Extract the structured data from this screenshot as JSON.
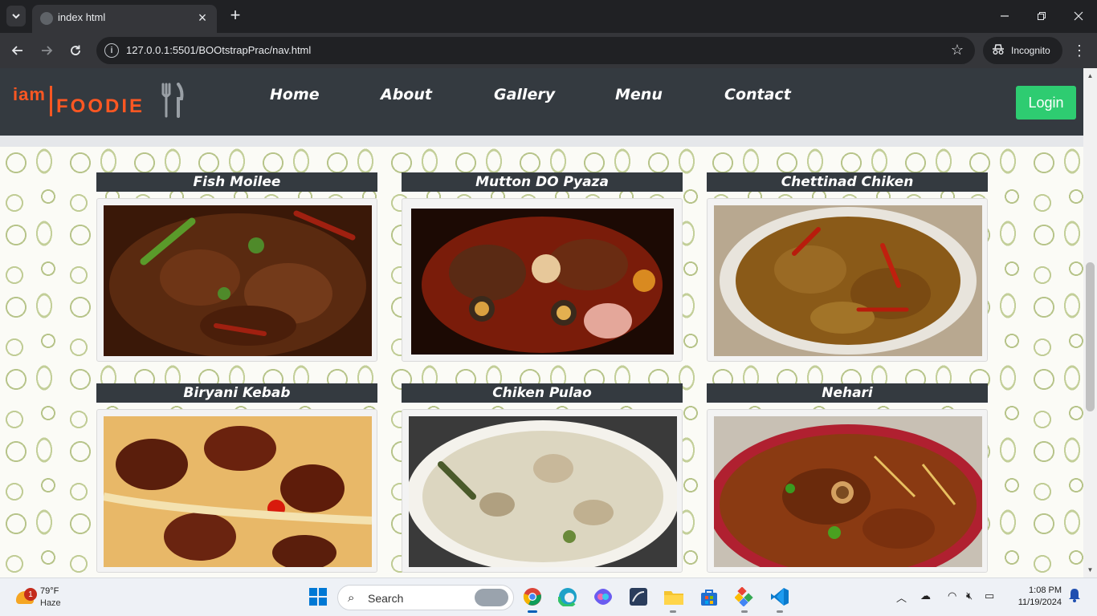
{
  "browser": {
    "tab_title": "index html",
    "url": "127.0.0.1:5501/BOOtstrapPrac/nav.html",
    "incognito_label": "Incognito"
  },
  "site": {
    "logo": {
      "prefix": "iam",
      "name": "FOODIE"
    },
    "nav": [
      "Home",
      "About",
      "Gallery",
      "Menu",
      "Contact"
    ],
    "login_label": "Login"
  },
  "dishes": [
    {
      "name": "Fish Moilee"
    },
    {
      "name": "Mutton DO Pyaza"
    },
    {
      "name": "Chettinad Chiken"
    },
    {
      "name": "Biryani Kebab"
    },
    {
      "name": "Chiken Pulao"
    },
    {
      "name": "Nehari"
    }
  ],
  "taskbar": {
    "weather_temp": "79°F",
    "weather_cond": "Haze",
    "weather_badge": "1",
    "search_label": "Search",
    "time": "1:08 PM",
    "date": "11/19/2024"
  },
  "colors": {
    "nav_bg": "#343a40",
    "brand_orange": "#ff5722",
    "login_green": "#2ecc71"
  }
}
